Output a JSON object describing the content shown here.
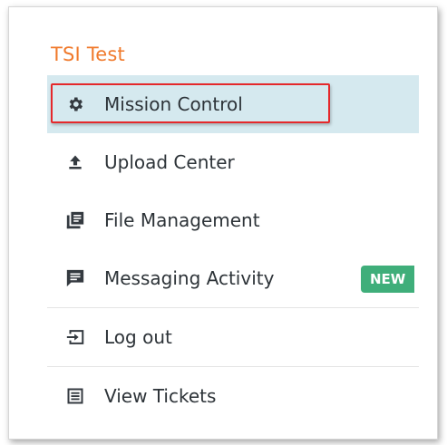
{
  "org": {
    "title": "TSI Test"
  },
  "menu": {
    "items": [
      {
        "label": "Mission Control",
        "icon": "gear-icon",
        "active": true,
        "highlighted": true
      },
      {
        "label": "Upload Center",
        "icon": "upload-icon"
      },
      {
        "label": "File Management",
        "icon": "file-stack-icon"
      },
      {
        "label": "Messaging Activity",
        "icon": "message-icon",
        "badge": "NEW"
      },
      {
        "label": "Log out",
        "icon": "logout-icon"
      },
      {
        "label": "View Tickets",
        "icon": "tickets-icon"
      }
    ]
  },
  "colors": {
    "title": "#f07a2c",
    "active_bg": "#d5e9ef",
    "highlight_border": "#e5282b",
    "badge_bg": "#3fae7a",
    "text": "#2d3338",
    "icon": "#343a40"
  }
}
